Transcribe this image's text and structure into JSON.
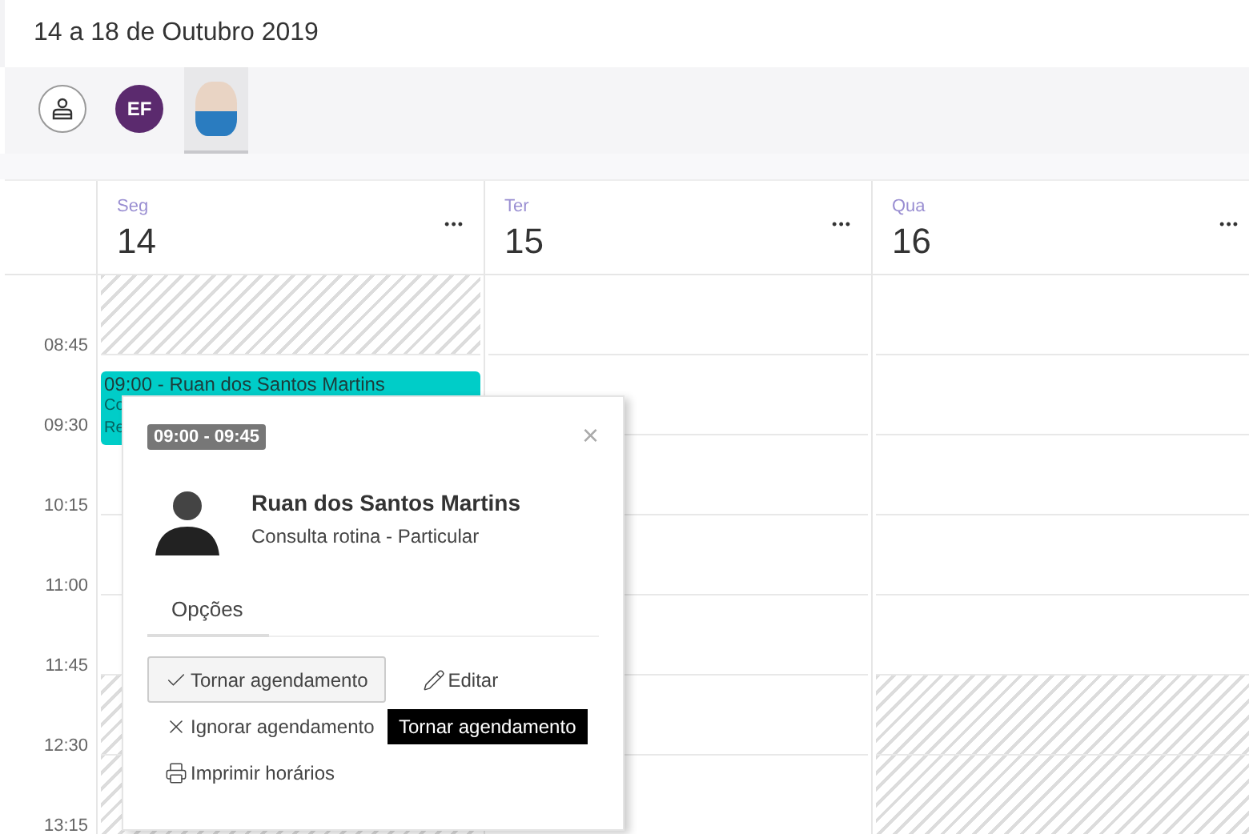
{
  "title": "14 a 18 de Outubro 2019",
  "professionals": [
    {
      "kind": "icon",
      "selected": false
    },
    {
      "kind": "initials",
      "initials": "EF",
      "color": "#5b2a6e",
      "selected": false
    },
    {
      "kind": "photo",
      "selected": true
    }
  ],
  "times": [
    "08:45",
    "09:30",
    "10:15",
    "11:00",
    "11:45",
    "12:30",
    "13:15"
  ],
  "days": [
    {
      "weekday": "Seg",
      "day": "14",
      "menu": "•••",
      "slots": [
        {
          "blocked": true
        },
        {
          "blocked": false
        },
        {
          "blocked": false
        },
        {
          "blocked": false
        },
        {
          "blocked": false
        },
        {
          "blocked": true
        },
        {
          "blocked": true
        }
      ],
      "events": [
        {
          "title": "09:00 - Ruan dos Santos Martins",
          "lines": [
            "Co",
            "Re"
          ],
          "color": "#00cdc8"
        }
      ]
    },
    {
      "weekday": "Ter",
      "day": "15",
      "menu": "•••",
      "slots": [
        {
          "blocked": false
        },
        {
          "blocked": false
        },
        {
          "blocked": false
        },
        {
          "blocked": false
        },
        {
          "blocked": false
        },
        {
          "blocked": false
        },
        {
          "blocked": false
        }
      ]
    },
    {
      "weekday": "Qua",
      "day": "16",
      "menu": "•••",
      "slots": [
        {
          "blocked": false
        },
        {
          "blocked": false
        },
        {
          "blocked": false
        },
        {
          "blocked": false
        },
        {
          "blocked": false
        },
        {
          "blocked": true
        },
        {
          "blocked": true
        }
      ]
    }
  ],
  "popup": {
    "time": "09:00 - 09:45",
    "close": "×",
    "name": "Ruan dos Santos Martins",
    "subtitle": "Consulta rotina - Particular",
    "tabs": [
      {
        "label": "Opções",
        "selected": true
      }
    ],
    "actions": [
      {
        "kind": "confirm",
        "label": "Tornar agendamento",
        "hovered": true
      },
      {
        "kind": "edit",
        "label": "Editar",
        "hovered": false
      },
      {
        "kind": "ignore",
        "label": "Ignorar agendamento",
        "hovered": false
      },
      {
        "kind": "print",
        "label": "Imprimir horários",
        "hovered": false
      }
    ],
    "tooltip": "Tornar agendamento"
  }
}
